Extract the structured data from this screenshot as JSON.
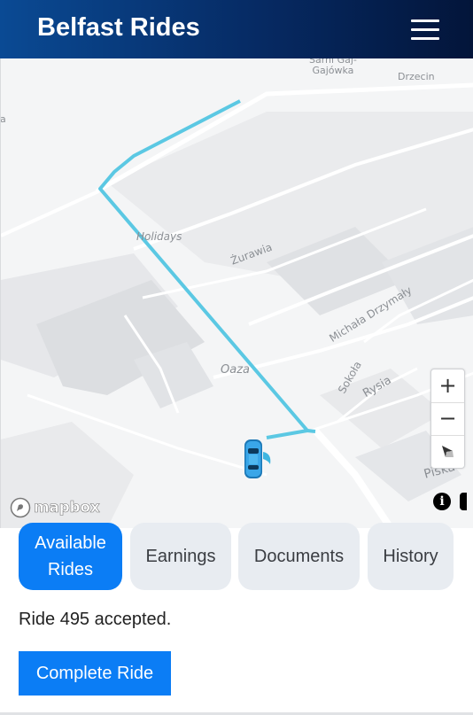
{
  "header": {
    "title": "Belfast Rides",
    "menu_icon": "hamburger-menu-icon"
  },
  "map": {
    "labels": [
      {
        "id": "sarni",
        "text": "Sarni Gaj-\nGajówka"
      },
      {
        "id": "drzecin",
        "text": "Drzecin"
      },
      {
        "id": "edge",
        "text": "na"
      },
      {
        "id": "holidays",
        "text": "Holidays"
      },
      {
        "id": "zurawia",
        "text": "Żurawia"
      },
      {
        "id": "drzymaly",
        "text": "Michała Drzymały"
      },
      {
        "id": "oaza",
        "text": "Oaza"
      },
      {
        "id": "sokola",
        "text": "Sokoła"
      },
      {
        "id": "rysia",
        "text": "Rysia"
      },
      {
        "id": "piska",
        "text": "Piska"
      }
    ],
    "zoom_in": "+",
    "zoom_out": "−",
    "attribution_logo": "mapbox",
    "info_label": "i",
    "route_color": "#5bc8e3",
    "vehicle_icon": "car-icon"
  },
  "tabs": [
    {
      "label": "Available Rides",
      "active": true
    },
    {
      "label": "Earnings",
      "active": false
    },
    {
      "label": "Documents",
      "active": false
    },
    {
      "label": "History",
      "active": false
    }
  ],
  "status": "Ride 495 accepted.",
  "actions": {
    "complete_label": "Complete Ride"
  },
  "colors": {
    "accent": "#0b7df5",
    "header_start": "#0a4a94",
    "header_end": "#03153a",
    "tab_inactive": "#e8ecf1"
  }
}
